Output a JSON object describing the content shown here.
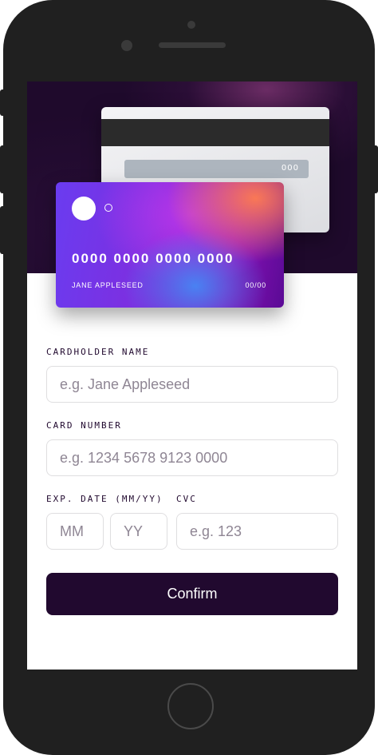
{
  "card_preview": {
    "number": "0000 0000 0000 0000",
    "holder": "JANE APPLESEED",
    "expiry": "00/00",
    "cvc": "000"
  },
  "form": {
    "name_label": "CARDHOLDER NAME",
    "name_placeholder": "e.g. Jane Appleseed",
    "number_label": "CARD NUMBER",
    "number_placeholder": "e.g. 1234 5678 9123 0000",
    "exp_label": "EXP. DATE (MM/YY)",
    "mm_placeholder": "MM",
    "yy_placeholder": "YY",
    "cvc_label": "CVC",
    "cvc_placeholder": "e.g. 123",
    "confirm_label": "Confirm"
  },
  "colors": {
    "primary": "#21092f",
    "input_border": "#dfdee0",
    "placeholder": "#8f8694"
  }
}
